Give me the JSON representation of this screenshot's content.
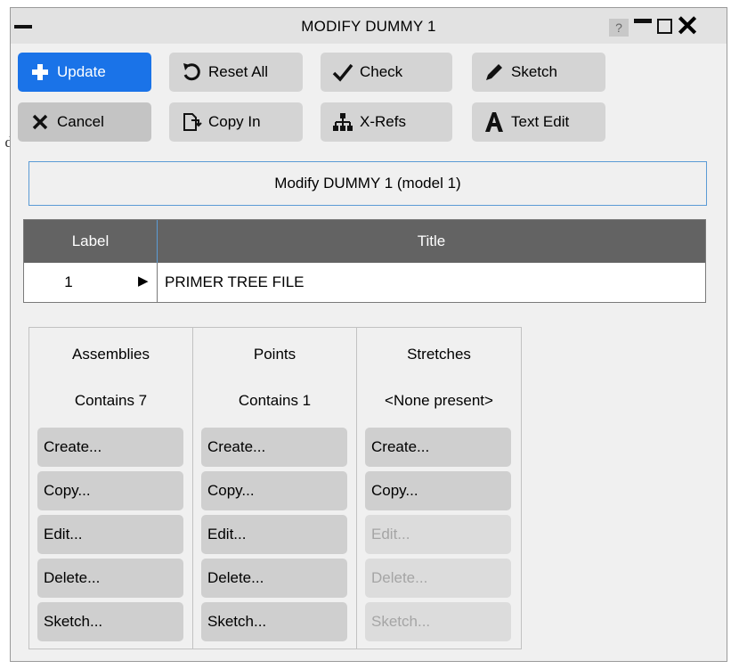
{
  "stray_char": "d",
  "window": {
    "title": "MODIFY DUMMY 1",
    "help_label": "?"
  },
  "toolbar": {
    "update": "Update",
    "reset_all": "Reset All",
    "check": "Check",
    "sketch": "Sketch",
    "cancel": "Cancel",
    "copy_in": "Copy In",
    "xrefs": "X-Refs",
    "text_edit": "Text Edit"
  },
  "header": "Modify DUMMY 1 (model 1)",
  "table": {
    "columns": [
      "Label",
      "Title"
    ],
    "rows": [
      {
        "label": "1",
        "title": "PRIMER TREE FILE"
      }
    ]
  },
  "panels": [
    {
      "name": "Assemblies",
      "contains": "Contains 7",
      "buttons": [
        {
          "label": "Create...",
          "enabled": true
        },
        {
          "label": "Copy...",
          "enabled": true
        },
        {
          "label": "Edit...",
          "enabled": true
        },
        {
          "label": "Delete...",
          "enabled": true
        },
        {
          "label": "Sketch...",
          "enabled": true
        }
      ]
    },
    {
      "name": "Points",
      "contains": "Contains 1",
      "buttons": [
        {
          "label": "Create...",
          "enabled": true
        },
        {
          "label": "Copy...",
          "enabled": true
        },
        {
          "label": "Edit...",
          "enabled": true
        },
        {
          "label": "Delete...",
          "enabled": true
        },
        {
          "label": "Sketch...",
          "enabled": true
        }
      ]
    },
    {
      "name": "Stretches",
      "contains": "<None present>",
      "buttons": [
        {
          "label": "Create...",
          "enabled": true
        },
        {
          "label": "Copy...",
          "enabled": true
        },
        {
          "label": "Edit...",
          "enabled": false
        },
        {
          "label": "Delete...",
          "enabled": false
        },
        {
          "label": "Sketch...",
          "enabled": false
        }
      ]
    }
  ],
  "colors": {
    "accent": "#1a73e8",
    "header_bg": "#636363",
    "focus_border": "#5b9bd5",
    "disabled_text": "#a5a5a5"
  }
}
